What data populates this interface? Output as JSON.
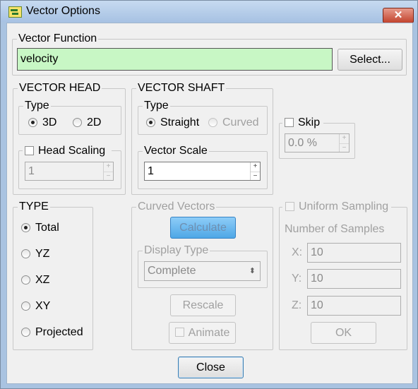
{
  "window": {
    "title": "Vector Options",
    "close_glyph": "✕"
  },
  "vector_function": {
    "label": "Vector Function",
    "value": "velocity",
    "select_button": "Select...",
    "value_bg": "#c8f7c5"
  },
  "vector_head": {
    "label": "VECTOR HEAD",
    "type_label": "Type",
    "options": [
      "3D",
      "2D"
    ],
    "selected": "3D",
    "scaling_label": "Head Scaling",
    "scaling_checked": false,
    "scaling_value": "1"
  },
  "vector_shaft": {
    "label": "VECTOR SHAFT",
    "type_label": "Type",
    "options": [
      "Straight",
      "Curved"
    ],
    "selected": "Straight",
    "scale_label": "Vector Scale",
    "scale_value": "1"
  },
  "skip": {
    "label": "Skip",
    "checked": false,
    "value": "0.0 %"
  },
  "type": {
    "label": "TYPE",
    "options": [
      "Total",
      "YZ",
      "XZ",
      "XY",
      "Projected"
    ],
    "selected": "Total"
  },
  "curved_vectors": {
    "label": "Curved Vectors",
    "calculate_button": "Calculate",
    "display_type_label": "Display Type",
    "display_type_value": "Complete",
    "rescale_button": "Rescale",
    "animate_label": "Animate"
  },
  "uniform_sampling": {
    "label": "Uniform Sampling",
    "checked": false,
    "samples_label": "Number of Samples",
    "x_label": "X:",
    "x_value": "10",
    "y_label": "Y:",
    "y_value": "10",
    "z_label": "Z:",
    "z_value": "10",
    "ok_button": "OK"
  },
  "close_button": "Close",
  "spin_up": "+",
  "spin_down": "−",
  "combo_glyph": "⬍"
}
